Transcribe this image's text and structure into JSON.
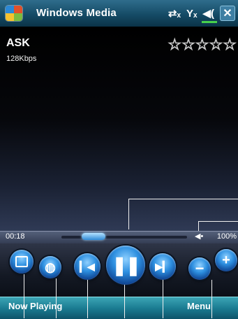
{
  "titlebar": {
    "app_title": "Windows Media",
    "start_icon": "windows-start-icon",
    "status_icons": [
      "connectivity-icon",
      "signal-off-icon",
      "speaker-icon"
    ],
    "close_label": "✕"
  },
  "now_playing": {
    "title": "ASK",
    "bitrate": "128Kbps",
    "rating_stars": 0,
    "rating_max": 5
  },
  "playback": {
    "elapsed": "00:18",
    "seek_fraction": 0.2,
    "volume_icon": "volume-icon",
    "volume_label": "100%"
  },
  "controls": [
    {
      "name": "skin-button",
      "icon": "skin-icon"
    },
    {
      "name": "web-button",
      "icon": "globe-icon"
    },
    {
      "name": "previous-button",
      "icon": "previous-icon"
    },
    {
      "name": "pause-button",
      "icon": "pause-icon"
    },
    {
      "name": "next-button",
      "icon": "next-icon"
    },
    {
      "name": "volume-down-button",
      "icon": "minus-icon"
    },
    {
      "name": "volume-up-button",
      "icon": "plus-icon"
    }
  ],
  "softkeys": {
    "left": "Now Playing",
    "right": "Menu"
  },
  "colors": {
    "titlebar": "#154b66",
    "softbar": "#1b7c92",
    "button": "#2d8fe0",
    "volume_ok": "#48d04c"
  }
}
